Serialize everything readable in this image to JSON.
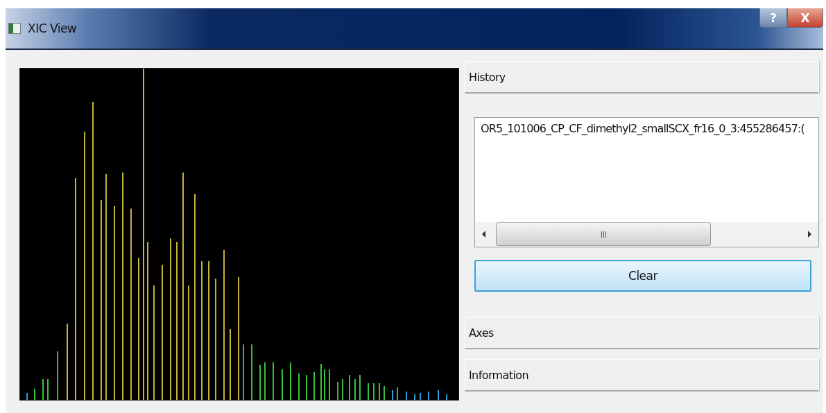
{
  "window": {
    "title": "XIC View"
  },
  "title_buttons": [
    {
      "kind": "help",
      "label": "?"
    },
    {
      "kind": "close",
      "label": "X"
    }
  ],
  "sections": [
    {
      "title": "History",
      "items": [
        "OR5_101006_CP_CF_dimethyl2_smallSCX_fr16_0_3:455286457:("
      ],
      "button": "Clear"
    },
    {
      "title": "Axes"
    },
    {
      "title": "Information"
    }
  ]
}
